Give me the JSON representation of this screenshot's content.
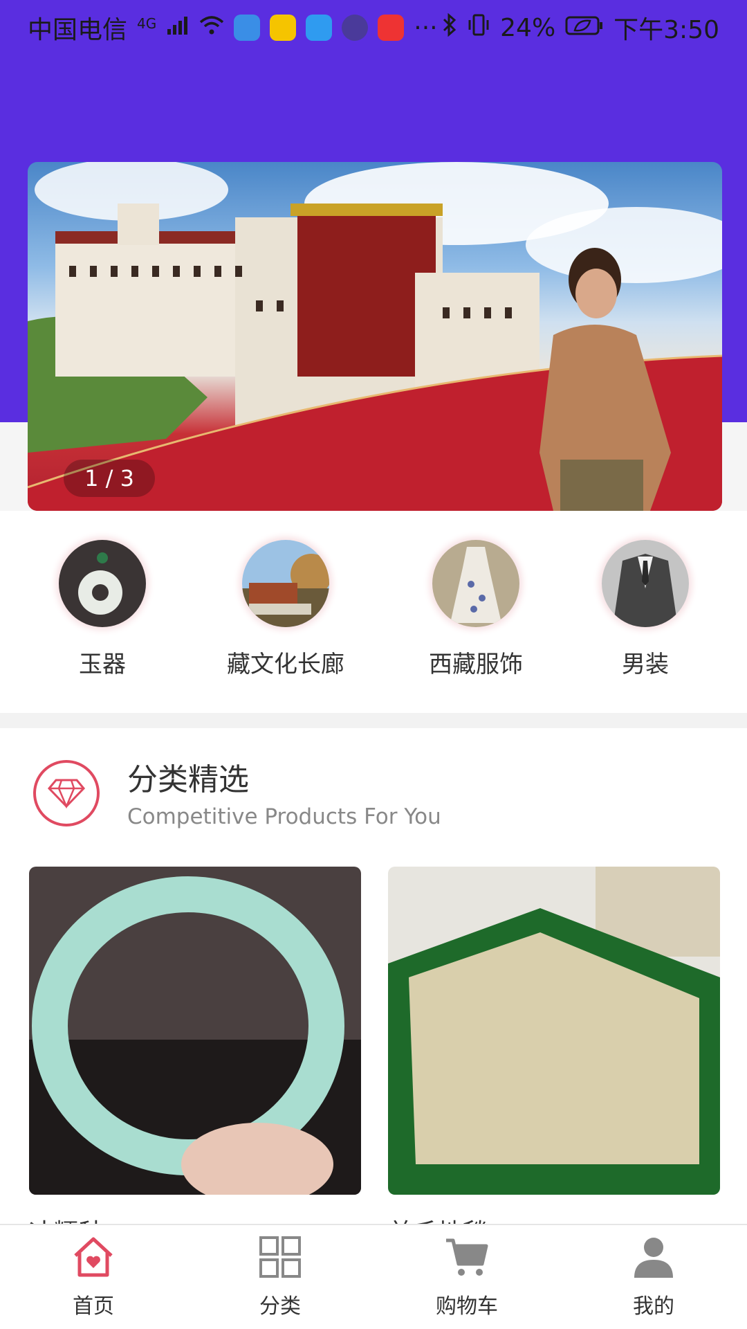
{
  "status_bar": {
    "carrier": "中国电信",
    "network": "4G",
    "battery": "24%",
    "time": "下午3:50",
    "more": "···"
  },
  "banner": {
    "indicator": "1 / 3"
  },
  "categories": [
    {
      "label": "玉器"
    },
    {
      "label": "藏文化长廊"
    },
    {
      "label": "西藏服饰"
    },
    {
      "label": "男装"
    }
  ],
  "section": {
    "title": "分类精选",
    "subtitle": "Competitive Products For You"
  },
  "products": [
    {
      "name": "冰糯种..."
    },
    {
      "name": "羊毛地毯"
    }
  ],
  "tabbar": [
    {
      "label": "首页",
      "icon": "home-icon",
      "active": true
    },
    {
      "label": "分类",
      "icon": "grid-icon",
      "active": false
    },
    {
      "label": "购物车",
      "icon": "cart-icon",
      "active": false
    },
    {
      "label": "我的",
      "icon": "user-icon",
      "active": false
    }
  ],
  "colors": {
    "header": "#5a2ee0",
    "accent": "#e04a61",
    "tab_inactive": "#888888"
  }
}
